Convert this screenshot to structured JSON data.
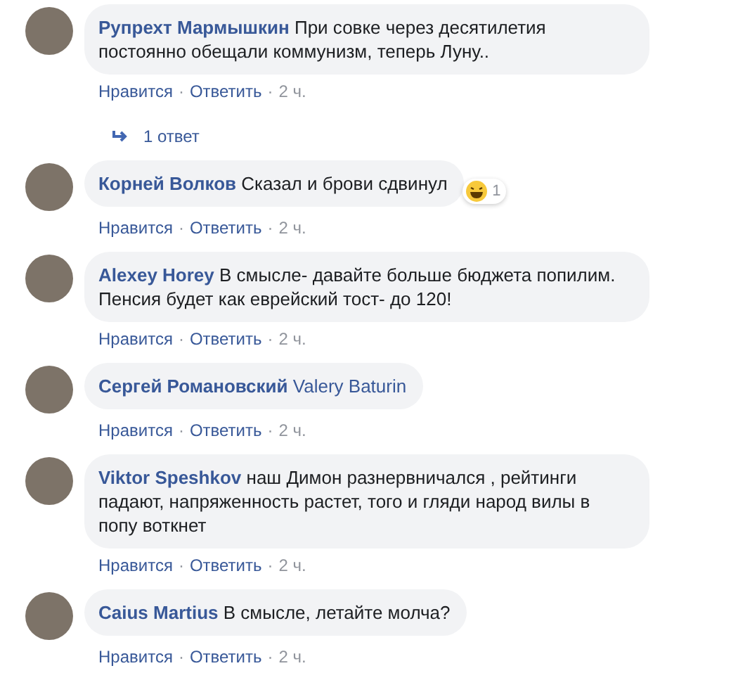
{
  "separator": "·",
  "comments": [
    {
      "author": "Рупрехт Мармышкин",
      "text": "При совке через десятилетия постоянно обещали коммунизм, теперь Луну..",
      "actions": [
        "Нравится",
        "Ответить"
      ],
      "time": "2 ч.",
      "replies": "1 ответ"
    },
    {
      "author": "Корней Волков",
      "text": "Сказал и брови сдвинул",
      "reaction": "1",
      "actions": [
        "Нравится",
        "Ответить"
      ],
      "time": "2 ч."
    },
    {
      "author": "Alexey Horey",
      "text": "В смысле- давайте больше бюджета попилим. Пенсия будет как еврейский тост- до 120!",
      "actions": [
        "Нравится",
        "Ответить"
      ],
      "time": "2 ч."
    },
    {
      "author": "Сергей Романовский",
      "mention": "Valery Baturin",
      "actions": [
        "Нравится",
        "Ответить"
      ],
      "time": "2 ч."
    },
    {
      "author": "Viktor Speshkov",
      "text": "наш Димон разнервничался , рейтинги падают, напряженность растет, того и гляди народ вилы в попу воткнет",
      "actions": [
        "Нравится",
        "Ответить"
      ],
      "time": "2 ч."
    },
    {
      "author": "Caius Martius",
      "text": "В смысле, летайте молча?",
      "actions": [
        "Нравится",
        "Ответить"
      ],
      "time": "2 ч."
    }
  ]
}
